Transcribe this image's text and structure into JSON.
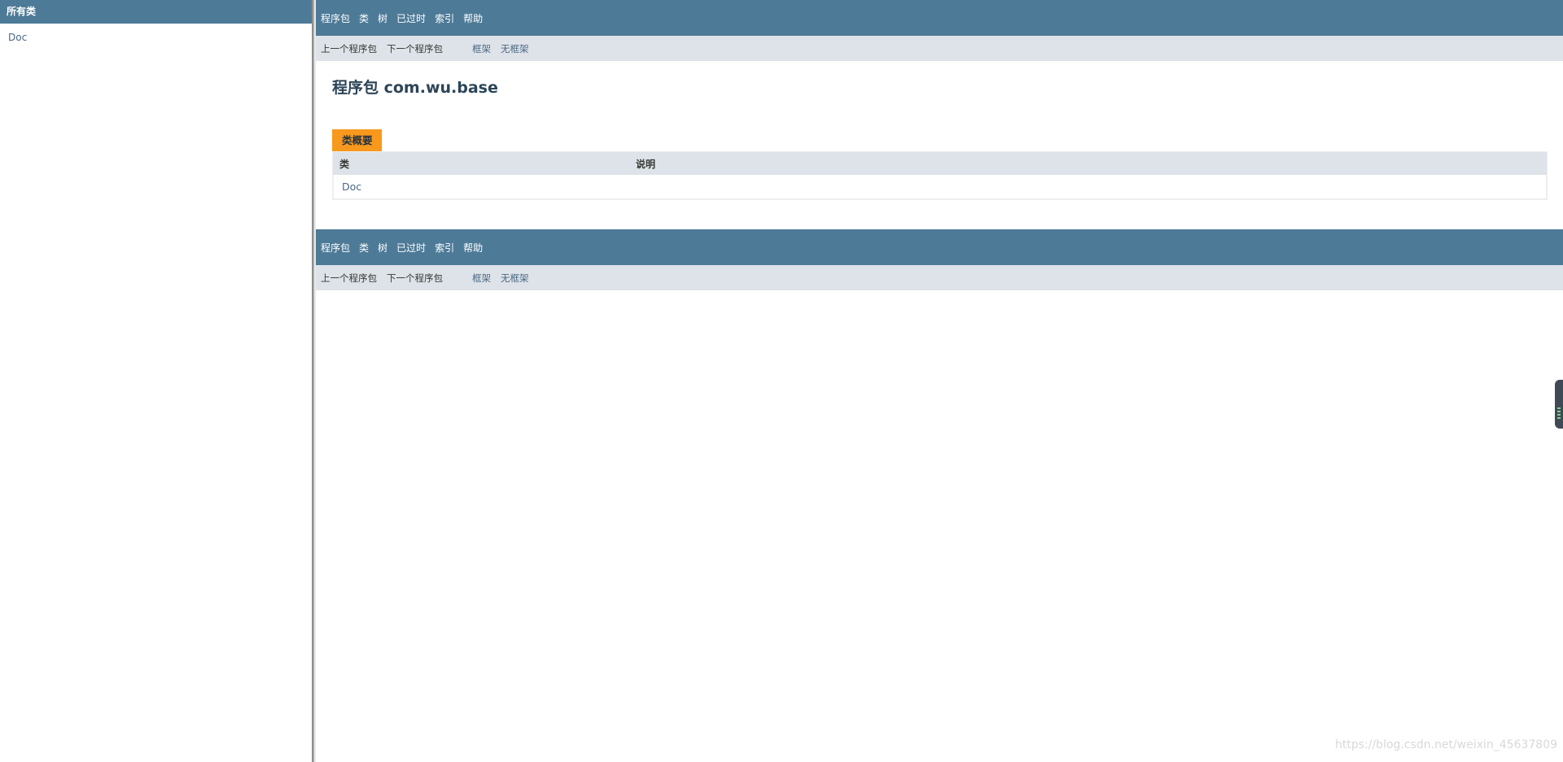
{
  "left_frame": {
    "header": "所有类",
    "classes": [
      "Doc"
    ]
  },
  "nav": {
    "items": [
      "程序包",
      "类",
      "树",
      "已过时",
      "索引",
      "帮助"
    ],
    "prev_package": "上一个程序包",
    "next_package": "下一个程序包",
    "frames": "框架",
    "no_frames": "无框架"
  },
  "page": {
    "title": "程序包 com.wu.base"
  },
  "class_summary": {
    "caption": "类概要",
    "columns": [
      "类",
      "说明"
    ],
    "rows": [
      {
        "name": "Doc",
        "description": ""
      }
    ]
  },
  "watermark": "https://blog.csdn.net/weixin_45637809",
  "colors": {
    "nav_bar": "#4D7A97",
    "sub_nav": "#DEE3E9",
    "caption_tab": "#F8981D",
    "link": "#4A6782"
  }
}
